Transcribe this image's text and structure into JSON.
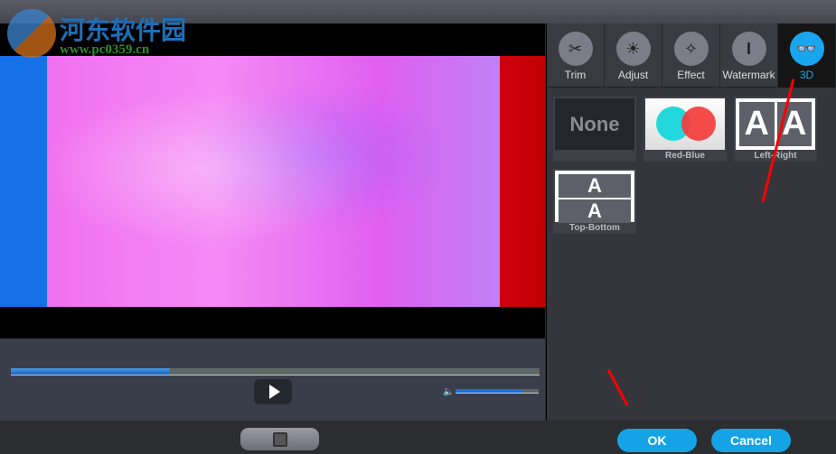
{
  "watermark": {
    "name": "河东软件园",
    "url": "www.pc0359.cn"
  },
  "tabs": [
    {
      "label": "Trim",
      "icon": "scissors-icon"
    },
    {
      "label": "Adjust",
      "icon": "brightness-icon"
    },
    {
      "label": "Effect",
      "icon": "magic-wand-icon"
    },
    {
      "label": "Watermark",
      "icon": "watermark-icon"
    },
    {
      "label": "3D",
      "icon": "3d-glasses-icon",
      "active": true
    }
  ],
  "options": [
    {
      "label": "",
      "thumb": "None"
    },
    {
      "label": "Red-Blue"
    },
    {
      "label": "Left-Right",
      "thumb": "A"
    },
    {
      "label": "Top-Bottom",
      "thumb": "A"
    }
  ],
  "player": {
    "progress_percent": 30,
    "volume_percent": 80
  },
  "buttons": {
    "ok": "OK",
    "cancel": "Cancel"
  },
  "colors": {
    "accent": "#14a4e6",
    "annotation": "#ff0000"
  }
}
